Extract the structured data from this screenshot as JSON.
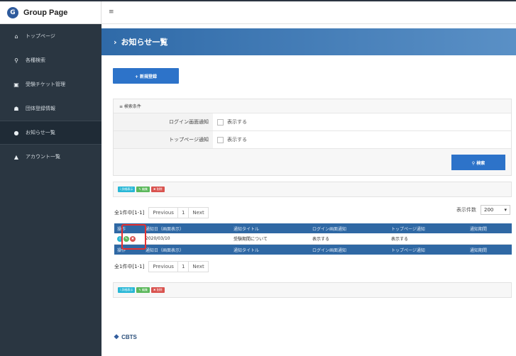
{
  "brand": {
    "logo_letter": "G",
    "name": "Group Page"
  },
  "topbar": {
    "menu_icon": "≡"
  },
  "sidebar": {
    "items": [
      {
        "icon": "⌂",
        "label": "トップページ"
      },
      {
        "icon": "⚲",
        "label": "各種検索"
      },
      {
        "icon": "▣",
        "label": "受験チケット管理"
      },
      {
        "icon": "☗",
        "label": "団体登録情報"
      },
      {
        "icon": "●",
        "label": "お知らせ一覧"
      },
      {
        "icon": "▲",
        "label": "アカウント一覧"
      }
    ]
  },
  "hero": {
    "chevron": "›",
    "title": "お知らせ一覧"
  },
  "actions": {
    "new_button": "+ 新規登録"
  },
  "search": {
    "panel_title": "≡ 検索条件",
    "row1_label": "ログイン画面通知",
    "row1_option": "表示する",
    "row2_label": "トップページ通知",
    "row2_option": "表示する",
    "search_button": "⚲ 検索"
  },
  "bulk": {
    "info": "i 詳細表示",
    "edit": "✎ 編集",
    "delete": "✖ 削除"
  },
  "pagination": {
    "count": "全1件中[1-1]",
    "previous": "Previous",
    "page": "1",
    "next": "Next"
  },
  "perpage": {
    "label": "表示件数",
    "value": "200",
    "arrow": "▾"
  },
  "table": {
    "headers": [
      "操作",
      "通知日（画面表示）",
      "通知タイトル",
      "ログイン画面通知",
      "トップページ通知",
      "通知期間"
    ],
    "row": {
      "date": "2020/03/10",
      "title": "受験期間について",
      "login": "表示する",
      "top": "表示する",
      "period": ""
    }
  },
  "footer": {
    "logo": "CBTS"
  }
}
